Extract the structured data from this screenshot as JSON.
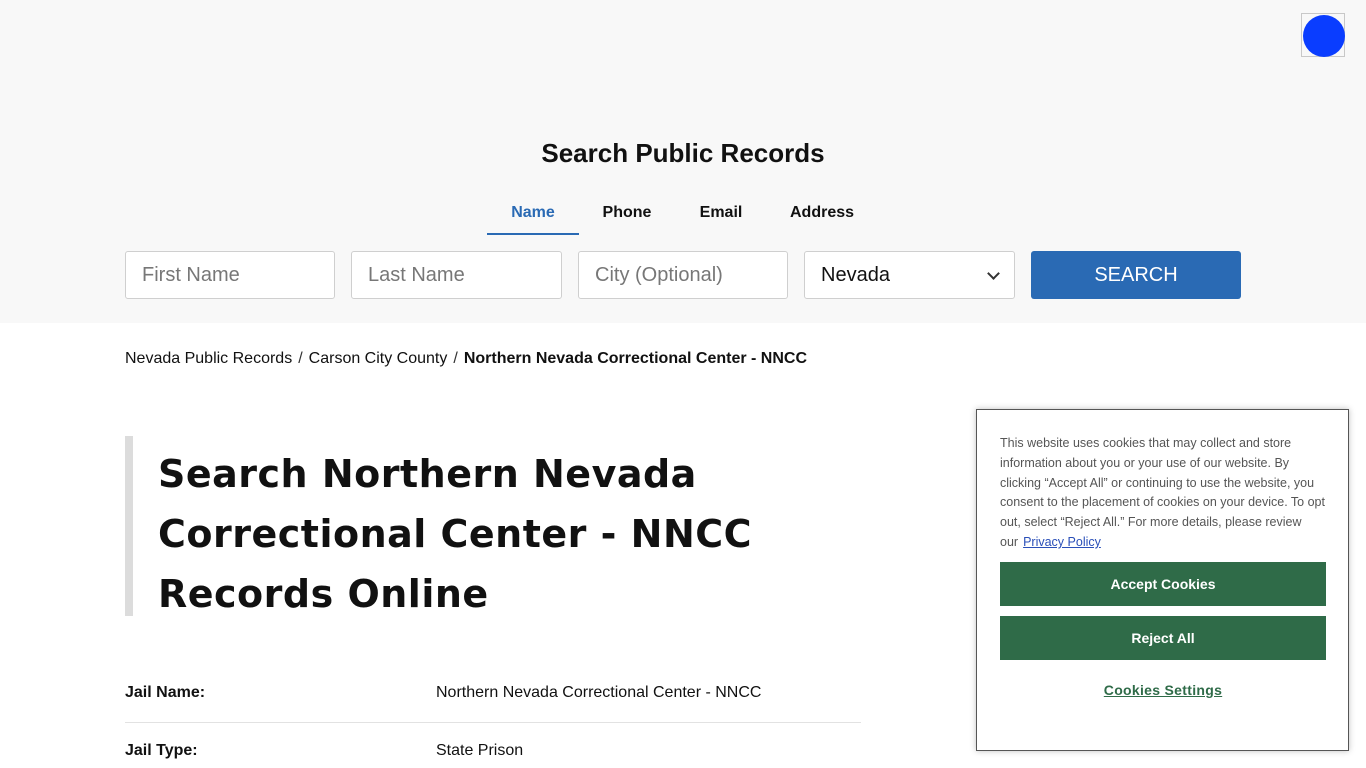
{
  "header": {
    "title": "Search Public Records",
    "logo_icon": "broken-image-icon",
    "tabs": [
      {
        "label": "Name",
        "active": true
      },
      {
        "label": "Phone",
        "active": false
      },
      {
        "label": "Email",
        "active": false
      },
      {
        "label": "Address",
        "active": false
      }
    ]
  },
  "search_form": {
    "first_name_placeholder": "First Name",
    "last_name_placeholder": "Last Name",
    "city_placeholder": "City (Optional)",
    "state_selected": "Nevada",
    "search_button": "SEARCH"
  },
  "breadcrumb": {
    "items": [
      "Nevada Public Records",
      "Carson City County"
    ],
    "current": "Northern Nevada Correctional Center - NNCC",
    "separator": "/"
  },
  "main": {
    "headline": "Search Northern Nevada Correctional Center - NNCC Records Online",
    "info": [
      {
        "label": "Jail Name:",
        "value": "Northern Nevada Correctional Center - NNCC"
      },
      {
        "label": "Jail Type:",
        "value": "State Prison"
      }
    ]
  },
  "cookie_banner": {
    "text": "This website uses cookies that may collect and store information about you or your use of our website. By clicking “Accept All” or continuing to use the website, you consent to the placement of cookies on your device. To opt out, select “Reject All.” For more details, please review our",
    "privacy_link": "Privacy Policy",
    "accept_button": "Accept Cookies",
    "reject_button": "Reject All",
    "settings_link": "Cookies Settings"
  },
  "colors": {
    "accent": "#2a6ab4",
    "cookie_button": "#2f6b48",
    "logo_circle": "#0a3dff"
  }
}
